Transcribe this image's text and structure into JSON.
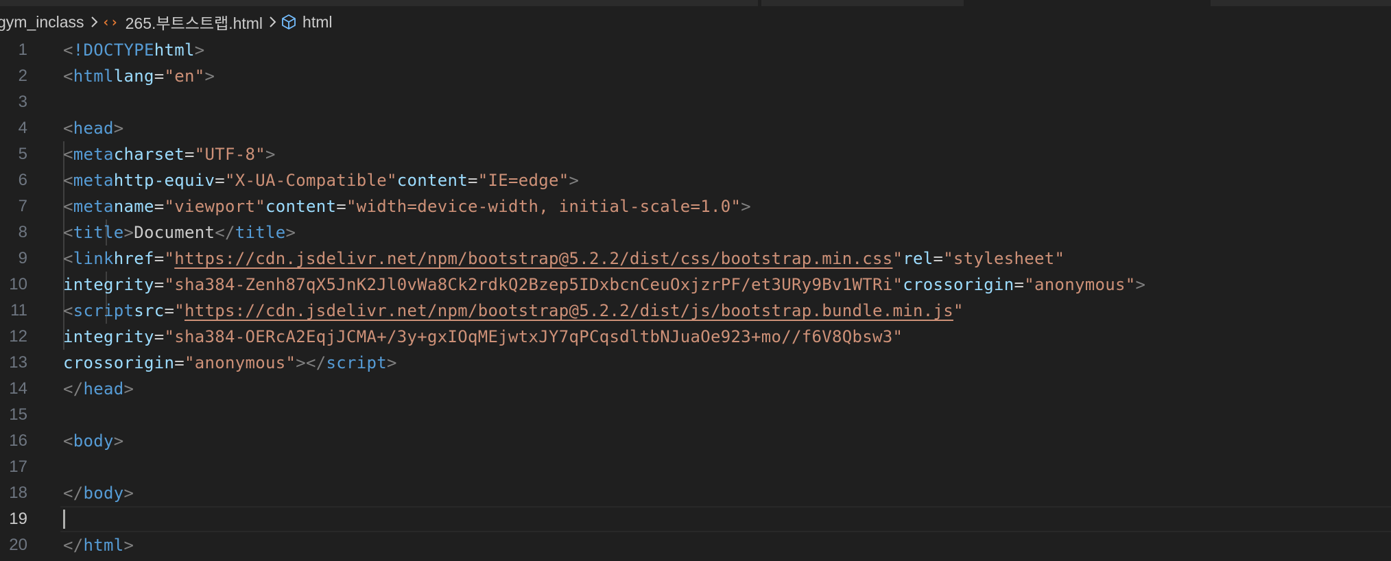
{
  "breadcrumb": {
    "folder": "gym_inclass",
    "file": "265.부트스트랩.html",
    "symbol": "html",
    "file_icon": "html-file-icon",
    "symbol_icon": "symbol-class-icon"
  },
  "editor": {
    "current_line": 19,
    "lines": [
      {
        "n": "1"
      },
      {
        "n": "2"
      },
      {
        "n": "3"
      },
      {
        "n": "4"
      },
      {
        "n": "5"
      },
      {
        "n": "6"
      },
      {
        "n": "7"
      },
      {
        "n": "8"
      },
      {
        "n": "9"
      },
      {
        "n": "10"
      },
      {
        "n": "11"
      },
      {
        "n": "12"
      },
      {
        "n": "13"
      },
      {
        "n": "14"
      },
      {
        "n": "15"
      },
      {
        "n": "16"
      },
      {
        "n": "17"
      },
      {
        "n": "18"
      },
      {
        "n": "19"
      },
      {
        "n": "20"
      }
    ],
    "tokens": {
      "l1": {
        "doctype": "!DOCTYPE",
        "html": "html"
      },
      "l2": {
        "tag": "html",
        "attr": "lang",
        "val": "\"en\""
      },
      "l4": {
        "tag": "head"
      },
      "l5": {
        "tag": "meta",
        "attr": "charset",
        "val": "\"UTF-8\""
      },
      "l6": {
        "tag": "meta",
        "attr1": "http-equiv",
        "val1": "\"X-UA-Compatible\"",
        "attr2": "content",
        "val2": "\"IE=edge\""
      },
      "l7": {
        "tag": "meta",
        "attr1": "name",
        "val1": "\"viewport\"",
        "attr2": "content",
        "val2": "\"width=device-width, initial-scale=1.0\""
      },
      "l8": {
        "tag": "title",
        "text": "Document",
        "tag_close": "title"
      },
      "l9": {
        "tag": "link",
        "attr1": "href",
        "url": "https://cdn.jsdelivr.net/npm/bootstrap@5.2.2/dist/css/bootstrap.min.css",
        "attr2": "rel",
        "val2": "\"stylesheet\""
      },
      "l10": {
        "attr1": "integrity",
        "val1": "\"sha384-Zenh87qX5JnK2Jl0vWa8Ck2rdkQ2Bzep5IDxbcnCeuOxjzrPF/et3URy9Bv1WTRi\"",
        "attr2": "crossorigin",
        "val2": "\"anonymous\""
      },
      "l11": {
        "tag": "script",
        "attr": "src",
        "url": "https://cdn.jsdelivr.net/npm/bootstrap@5.2.2/dist/js/bootstrap.bundle.min.js"
      },
      "l12": {
        "attr": "integrity",
        "val": "\"sha384-OERcA2EqjJCMA+/3y+gxIOqMEjwtxJY7qPCqsdltbNJuaOe923+mo//f6V8Qbsw3\""
      },
      "l13": {
        "attr": "crossorigin",
        "val": "\"anonymous\"",
        "tag_close": "script"
      },
      "l14": {
        "tag": "head"
      },
      "l16": {
        "tag": "body"
      },
      "l18": {
        "tag": "body"
      },
      "l20": {
        "tag": "html"
      }
    }
  },
  "colors": {
    "background": "#1f1f1f",
    "tag": "#569cd6",
    "attribute": "#9cdcfe",
    "string": "#ce9178",
    "punctuation": "#808080",
    "line_number": "#6e7681",
    "file_icon": "#e37933"
  }
}
